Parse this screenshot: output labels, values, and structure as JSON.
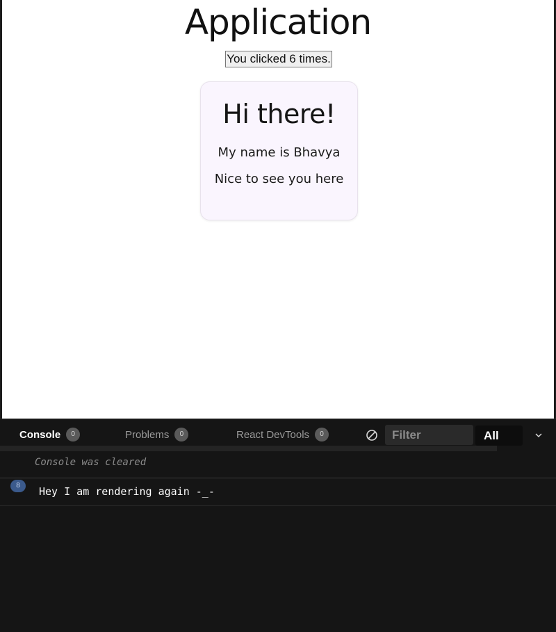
{
  "app": {
    "title": "Application",
    "count_button_label": "You clicked 6 times."
  },
  "card": {
    "title": "Hi there!",
    "line1": "My name is Bhavya",
    "line2": "Nice to see you here"
  },
  "devtools": {
    "tabs": [
      {
        "label": "Console",
        "count": "0",
        "active": true
      },
      {
        "label": "Problems",
        "count": "0",
        "active": false
      },
      {
        "label": "React DevTools",
        "count": "0",
        "active": false
      }
    ],
    "filter_placeholder": "Filter",
    "level": "All",
    "cleared_message": "Console was cleared",
    "log": {
      "repeat_count": "8",
      "message": "Hey I am rendering again -_-"
    },
    "icons": [
      "clear-console-icon",
      "chevron-down-icon"
    ]
  },
  "colors": {
    "card_bg": "#faf5fe",
    "console_bg": "#151515",
    "repeat_badge": "#3b5a8c"
  }
}
